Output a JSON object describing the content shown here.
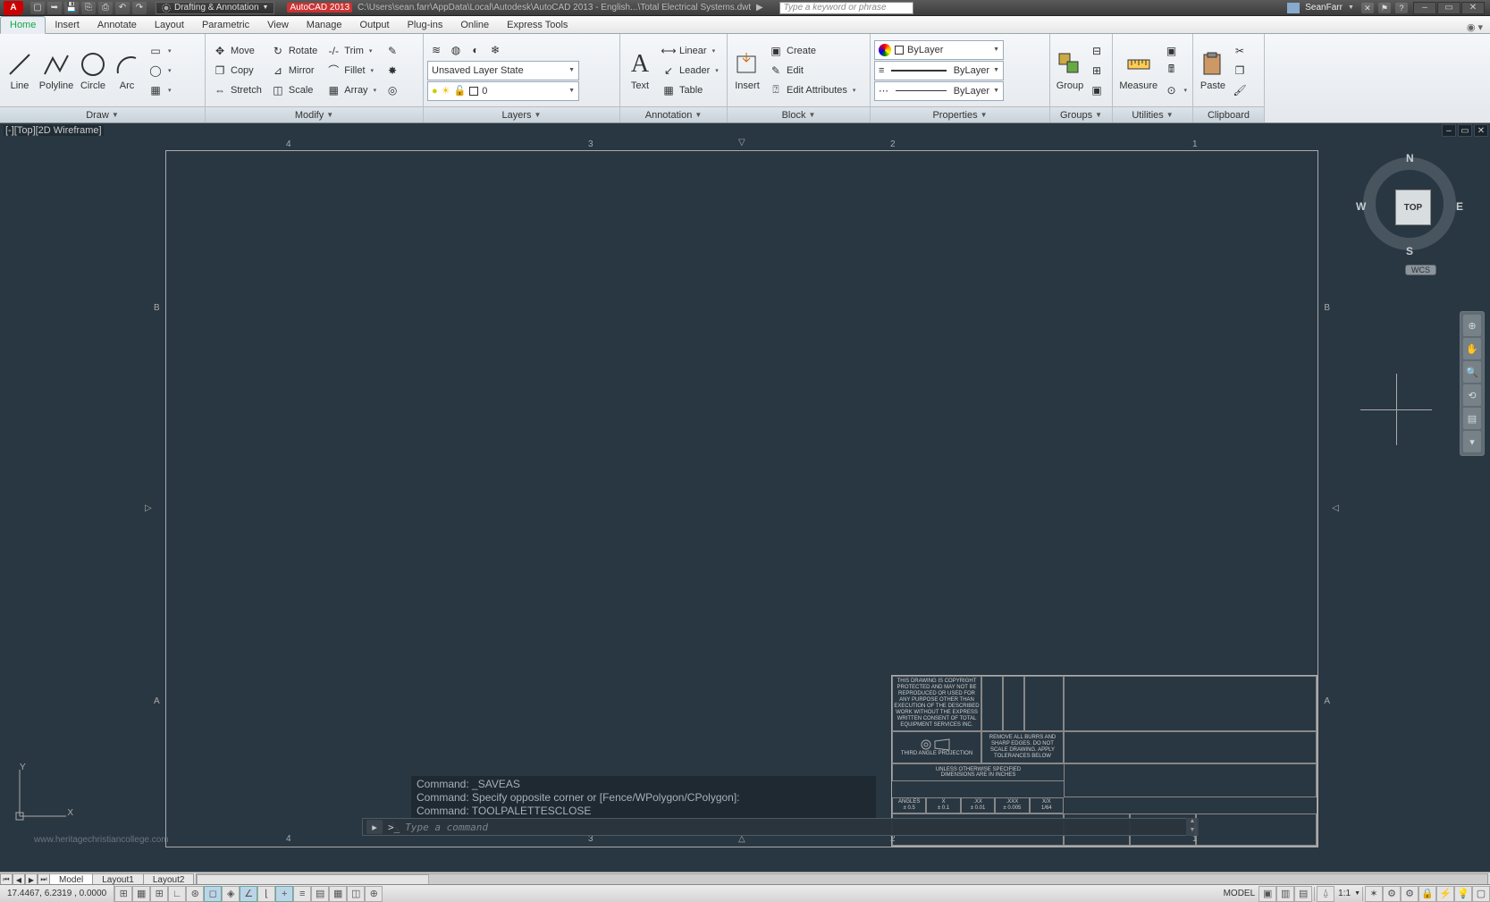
{
  "title": {
    "app": "A",
    "workspace": "Drafting & Annotation",
    "doc_prefix": "AutoCAD 2013",
    "doc_path": "C:\\Users\\sean.farr\\AppData\\Local\\Autodesk\\AutoCAD 2013 - English...\\Total Electrical Systems.dwt",
    "search_placeholder": "Type a keyword or phrase",
    "user": "SeanFarr"
  },
  "tabs": [
    "Home",
    "Insert",
    "Annotate",
    "Layout",
    "Parametric",
    "View",
    "Manage",
    "Output",
    "Plug-ins",
    "Online",
    "Express Tools"
  ],
  "tabs_active": 0,
  "panels": {
    "draw": {
      "title": "Draw",
      "line": "Line",
      "polyline": "Polyline",
      "circle": "Circle",
      "arc": "Arc"
    },
    "modify": {
      "title": "Modify",
      "move": "Move",
      "rotate": "Rotate",
      "trim": "Trim",
      "copy": "Copy",
      "mirror": "Mirror",
      "fillet": "Fillet",
      "stretch": "Stretch",
      "scale": "Scale",
      "array": "Array"
    },
    "layers": {
      "title": "Layers",
      "state": "Unsaved Layer State",
      "current": "0"
    },
    "annotation": {
      "title": "Annotation",
      "text": "Text",
      "linear": "Linear",
      "leader": "Leader",
      "table": "Table"
    },
    "block": {
      "title": "Block",
      "insert": "Insert",
      "create": "Create",
      "edit": "Edit",
      "editattr": "Edit Attributes"
    },
    "properties": {
      "title": "Properties",
      "color": "ByLayer",
      "lw": "ByLayer",
      "lt": "ByLayer"
    },
    "groups": {
      "title": "Groups",
      "group": "Group"
    },
    "utilities": {
      "title": "Utilities",
      "measure": "Measure"
    },
    "clipboard": {
      "title": "Clipboard",
      "paste": "Paste"
    }
  },
  "viewport": {
    "label": "[-][Top][2D Wireframe]",
    "cube": "TOP",
    "cube_dir": {
      "n": "N",
      "e": "E",
      "s": "S",
      "w": "W"
    },
    "wcs": "WCS",
    "ucs": {
      "x": "X",
      "y": "Y"
    },
    "ruler_cols": [
      "4",
      "3",
      "2",
      "1"
    ],
    "ruler_rows": [
      "B",
      "A"
    ]
  },
  "titleblock": {
    "copyright": "THIS DRAWING IS COPYRIGHT PROTECTED AND MAY NOT BE REPRODUCED OR USED FOR ANY PURPOSE OTHER THAN EXECUTION OF THE DESCRIBED WORK WITHOUT THE EXPRESS WRITTEN CONSENT OF TOTAL EQUIPMENT SERVICES INC.",
    "proj_note": "THIRD ANGLE PROJECTION",
    "burr_note": "REMOVE ALL BURRS AND SHARP EDGES. DO NOT SCALE DRAWING. APPLY TOLERANCES BELOW",
    "dim_note1": "UNLESS OTHERWISE SPECIFIED",
    "dim_note2": "DIMENSIONS ARE IN INCHES",
    "tol_hdr": [
      "ANGLES",
      "X",
      ".XX",
      ".XXX",
      "X/X"
    ],
    "tol_val": [
      "± 0.5",
      "± 0.1",
      "± 0.01",
      "± 0.005",
      "1/64"
    ]
  },
  "command": {
    "hist": [
      "Command: _SAVEAS",
      "Command: Specify opposite corner or [Fence/WPolygon/CPolygon]:",
      "Command: TOOLPALETTESCLOSE"
    ],
    "prompt": ">_",
    "placeholder": "Type a command"
  },
  "layout_tabs": [
    "Model",
    "Layout1",
    "Layout2"
  ],
  "layout_active": 0,
  "status": {
    "coords": "17.4467, 6.2319 , 0.0000",
    "space": "MODEL",
    "scale": "1:1"
  },
  "watermark": "www.heritagechristiancollege.com"
}
